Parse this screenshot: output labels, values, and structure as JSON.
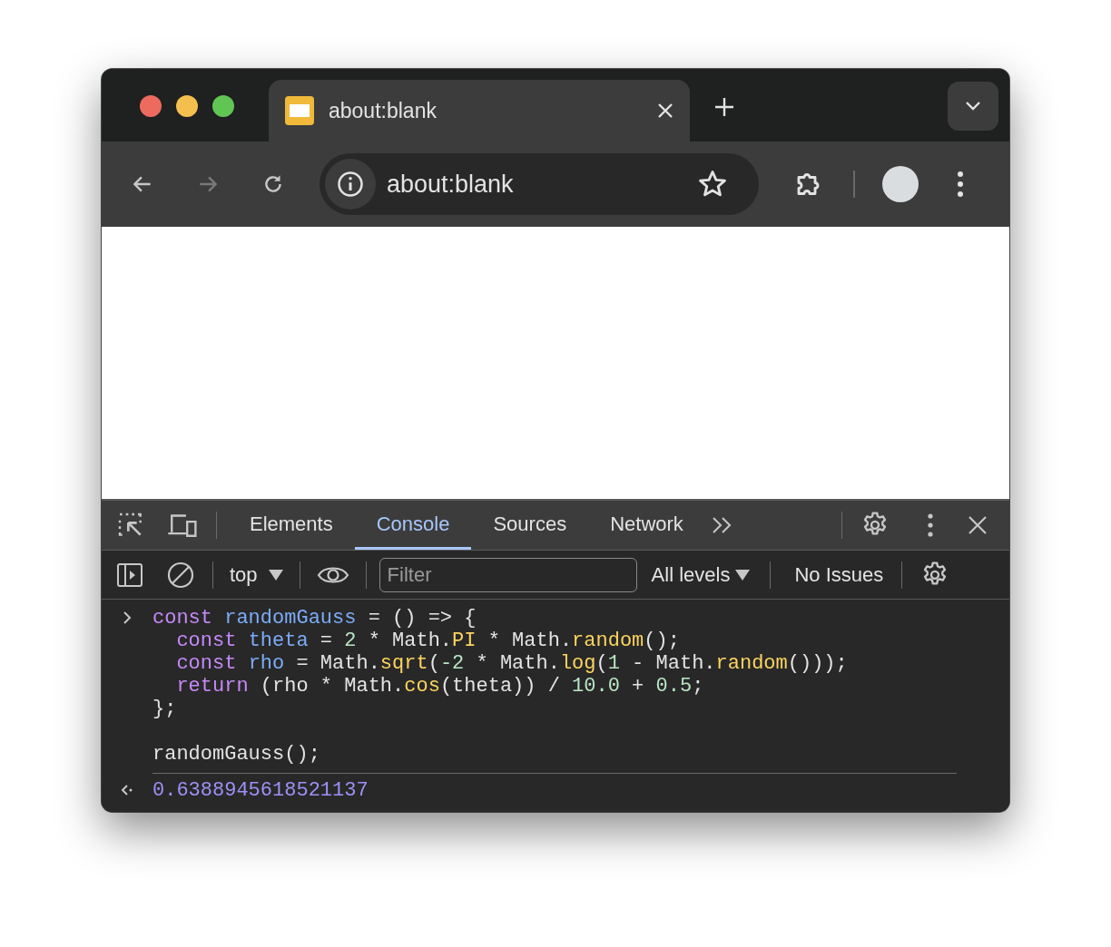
{
  "tabs": [
    {
      "title": "about:blank",
      "selected": true
    }
  ],
  "toolbar": {
    "address": "about:blank"
  },
  "devtools": {
    "tabs": [
      {
        "label": "Elements",
        "selected": false
      },
      {
        "label": "Console",
        "selected": true
      },
      {
        "label": "Sources",
        "selected": false
      },
      {
        "label": "Network",
        "selected": false
      }
    ],
    "console_toolbar": {
      "context": "top",
      "filter_placeholder": "Filter",
      "levels": "All levels",
      "issues": "No Issues"
    },
    "console": {
      "input": [
        {
          "lines": [
            {
              "tokens": [
                {
                  "kind": "keyword",
                  "text": "const "
                },
                {
                  "kind": "def",
                  "text": "randomGauss"
                },
                {
                  "kind": "plain",
                  "text": " = () => {"
                }
              ]
            },
            {
              "tokens": [
                {
                  "kind": "keyword",
                  "text": "  const "
                },
                {
                  "kind": "def",
                  "text": "theta"
                },
                {
                  "kind": "plain",
                  "text": " = "
                },
                {
                  "kind": "number",
                  "text": "2"
                },
                {
                  "kind": "plain",
                  "text": " * Math."
                },
                {
                  "kind": "method",
                  "text": "PI"
                },
                {
                  "kind": "plain",
                  "text": " * Math."
                },
                {
                  "kind": "method",
                  "text": "random"
                },
                {
                  "kind": "plain",
                  "text": "();"
                }
              ]
            },
            {
              "tokens": [
                {
                  "kind": "keyword",
                  "text": "  const "
                },
                {
                  "kind": "def",
                  "text": "rho"
                },
                {
                  "kind": "plain",
                  "text": " = Math."
                },
                {
                  "kind": "method",
                  "text": "sqrt"
                },
                {
                  "kind": "plain",
                  "text": "("
                },
                {
                  "kind": "number",
                  "text": "-2"
                },
                {
                  "kind": "plain",
                  "text": " * Math."
                },
                {
                  "kind": "method",
                  "text": "log"
                },
                {
                  "kind": "plain",
                  "text": "("
                },
                {
                  "kind": "number",
                  "text": "1"
                },
                {
                  "kind": "plain",
                  "text": " - Math."
                },
                {
                  "kind": "method",
                  "text": "random"
                },
                {
                  "kind": "plain",
                  "text": "()));"
                }
              ]
            },
            {
              "tokens": [
                {
                  "kind": "keyword",
                  "text": "  return"
                },
                {
                  "kind": "plain",
                  "text": " (rho * Math."
                },
                {
                  "kind": "method",
                  "text": "cos"
                },
                {
                  "kind": "plain",
                  "text": "(theta)) / "
                },
                {
                  "kind": "number",
                  "text": "10.0"
                },
                {
                  "kind": "plain",
                  "text": " + "
                },
                {
                  "kind": "number",
                  "text": "0.5"
                },
                {
                  "kind": "plain",
                  "text": ";"
                }
              ]
            },
            {
              "tokens": [
                {
                  "kind": "plain",
                  "text": "};"
                }
              ]
            }
          ]
        },
        {
          "lines": [
            {
              "tokens": [
                {
                  "kind": "plain",
                  "text": "randomGauss();"
                }
              ]
            }
          ]
        }
      ],
      "result": "0.6388945618521137"
    }
  }
}
